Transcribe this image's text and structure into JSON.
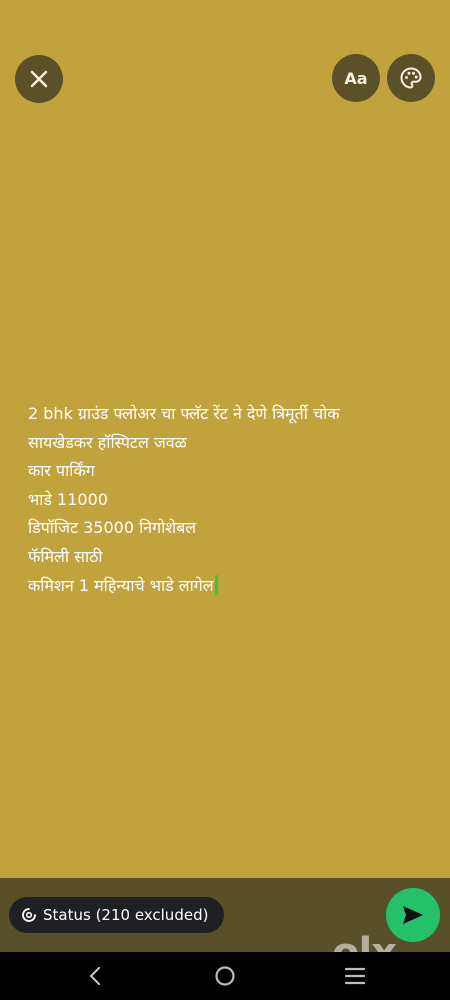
{
  "toolbar": {
    "font_label": "Aa"
  },
  "status_text": "2 bhk ग्राउंड फ्लोअर चा फ्लॅट रेंट ने देणे  त्रिमूर्ती चोक\nसायखेडकर हॉस्पिटल जवळ\nकार पार्किंग\nभाडे 11000\nडिपॉजिट 35000 निगोशेबल\nफॅमिली साठी\nकमिशन 1 महिन्याचे भाडे लागेल",
  "bottom": {
    "status_chip_label": "Status (210 excluded)"
  },
  "watermark": "olx",
  "colors": {
    "background": "#c1a33e",
    "send": "#25c06a",
    "cursor": "#2fcb46"
  },
  "icons": [
    "close-icon",
    "palette-icon",
    "status-ring-icon",
    "send-icon",
    "back-icon",
    "home-icon",
    "recents-icon"
  ]
}
